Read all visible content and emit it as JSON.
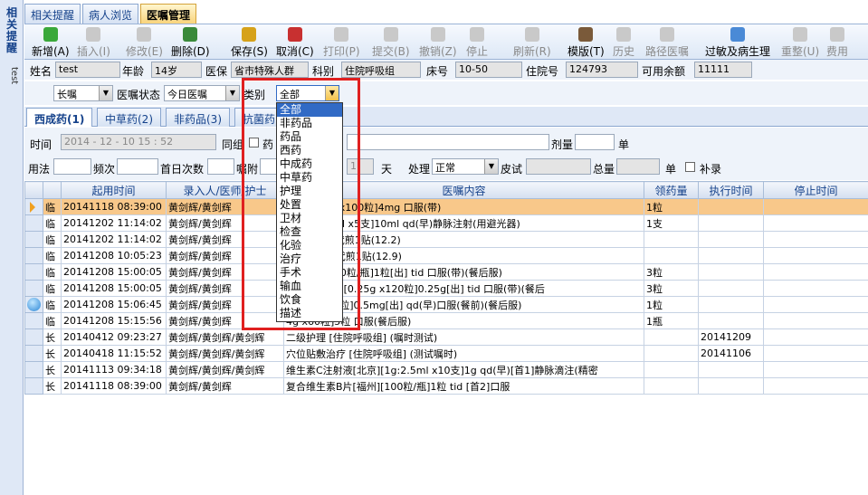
{
  "leftbar": {
    "title": "相关提醒",
    "vertical": "test"
  },
  "tabs": [
    "相关提醒",
    "病人浏览",
    "医嘱管理"
  ],
  "toolbar": [
    {
      "label": "新增(A)",
      "icon": "add-icon",
      "enabled": true,
      "color": "#3aa83a"
    },
    {
      "label": "插入(I)",
      "icon": "insert-icon",
      "enabled": false
    },
    {
      "label": "修改(E)",
      "icon": "edit-icon",
      "enabled": false
    },
    {
      "label": "删除(D)",
      "icon": "delete-icon",
      "enabled": true,
      "color": "#3a8a3a"
    },
    {
      "label": "保存(S)",
      "icon": "save-icon",
      "enabled": true,
      "color": "#d6a21a"
    },
    {
      "label": "取消(C)",
      "icon": "cancel-icon",
      "enabled": true,
      "color": "#c83030"
    },
    {
      "label": "打印(P)",
      "icon": "print-icon",
      "enabled": false
    },
    {
      "label": "提交(B)",
      "icon": "submit-icon",
      "enabled": false
    },
    {
      "label": "撤销(Z)",
      "icon": "undo-icon",
      "enabled": false
    },
    {
      "label": "停止",
      "icon": "stop-icon",
      "enabled": false
    },
    {
      "label": "刷新(R)",
      "icon": "refresh-icon",
      "enabled": false
    },
    {
      "label": "模版(T)",
      "icon": "template-icon",
      "enabled": true,
      "color": "#7a5a3a"
    },
    {
      "label": "历史",
      "icon": "history-icon",
      "enabled": false
    },
    {
      "label": "路径医嘱",
      "icon": "path-icon",
      "enabled": false
    },
    {
      "label": "过敏及病生理",
      "icon": "allergy-icon",
      "enabled": true,
      "color": "#4a8ad6"
    },
    {
      "label": "重整(U)",
      "icon": "reorganize-icon",
      "enabled": false
    },
    {
      "label": "费用",
      "icon": "fee-icon",
      "enabled": false
    }
  ],
  "patient": {
    "name_label": "姓名",
    "name": "test",
    "age_label": "年龄",
    "age": "14岁",
    "insurance_label": "医保",
    "insurance": "省市特殊人群",
    "dept_label": "科别",
    "dept": "住院呼吸组",
    "bed_label": "床号",
    "bed": "10-50",
    "hosp_label": "住院号",
    "hosp": "124793",
    "balance_label": "可用余额",
    "balance": "11111"
  },
  "filters": {
    "type": "长嘱",
    "status_label": "医嘱状态",
    "status": "今日医嘱",
    "category_label": "类别",
    "category": "全部"
  },
  "subtabs": [
    "西成药(1)",
    "中草药(2)",
    "非药品(3)",
    "抗菌药"
  ],
  "form": {
    "time_label": "时间",
    "time": "2014 - 12 - 10   15 : 52",
    "group_label": "同组",
    "drug_label": "药",
    "dose_label": "剂量",
    "dose_unit": "单",
    "usage_label": "用法",
    "freq_label": "频次",
    "first_label": "首日次数",
    "instr_label": "嘱附",
    "days_unit": "天",
    "process_label": "处理",
    "process": "正常",
    "skintest_label": "皮试",
    "total_label": "总量",
    "total_unit": "单",
    "supp_label": "补录",
    "days_value": "1"
  },
  "dropdown": [
    "全部",
    "非药品",
    "药品",
    "西药",
    "中成药",
    "中草药",
    "护理",
    "处置",
    "卫材",
    "检查",
    "化验",
    "治疗",
    "手术",
    "输血",
    "饮食",
    "描述"
  ],
  "grid": {
    "headers": [
      "",
      "起用时间",
      "录入人/医师/护士",
      "医嘱内容",
      "领药量",
      "执行时间",
      "停止时间"
    ],
    "rows": [
      {
        "type": "临",
        "start": "20141118 08:39:00",
        "doctor": "黄剑辉/黄剑辉",
        "content": "福州][4mg x100粒]4mg   口服(带)",
        "qty": "1粒",
        "exec": "",
        "stop": ""
      },
      {
        "type": "临",
        "start": "20141202 11:14:02",
        "doctor": "黄剑辉/黄剑辉",
        "content": "生射液[10ml x5支]10ml   qd(早)静脉注射(用避光器)",
        "qty": "1支",
        "exec": "",
        "stop": ""
      },
      {
        "type": "临",
        "start": "20141202 11:14:02",
        "doctor": "黄剑辉/黄剑辉",
        "content": "9g]1g   1贴代煎1贴(12.2)",
        "qty": "",
        "exec": "",
        "stop": ""
      },
      {
        "type": "临",
        "start": "20141208 10:05:23",
        "doctor": "黄剑辉/黄剑辉",
        "content": "袋]1克   1贴代煎1贴(12.9)",
        "qty": "",
        "exec": "",
        "stop": ""
      },
      {
        "type": "临",
        "start": "20141208 15:00:05",
        "doctor": "黄剑辉/黄剑辉",
        "content": "片[福州][100粒/瓶]1粒[出]   tid 口服(带)(餐后服)",
        "qty": "3粒",
        "exec": "",
        "stop": ""
      },
      {
        "type": "临",
        "start": "20141208 15:00:05",
        "doctor": "黄剑辉/黄剑辉",
        "content": "致钾片[海南][0.25g x120粒]0.25g[出]   tid 口服(带)(餐后",
        "qty": "3粒",
        "exec": "",
        "stop": ""
      },
      {
        "type": "临",
        "start": "20141208 15:06:45",
        "doctor": "黄剑辉/黄剑辉",
        "content": "0.5mg x20粒]0.5mg[出]   qd(早)口服(餐前)(餐后服)",
        "qty": "1粒",
        "exec": "",
        "stop": ""
      },
      {
        "type": "临",
        "start": "20141208 15:15:56",
        "doctor": "黄剑辉/黄剑辉",
        "content": "4g x60粒]5粒   口服(餐后服)",
        "qty": "1瓶",
        "exec": "",
        "stop": ""
      },
      {
        "type": "长",
        "start": "20140412 09:23:27",
        "doctor": "黄剑辉/黄剑辉/黄剑辉",
        "content": "二级护理   [住院呼吸组]   (嘱时测试)",
        "qty": "",
        "exec": "20141209",
        "stop": ""
      },
      {
        "type": "长",
        "start": "20140418 11:15:52",
        "doctor": "黄剑辉/黄剑辉/黄剑辉",
        "content": "穴位贴敷治疗   [住院呼吸组]   (测试嘱时)",
        "qty": "",
        "exec": "20141106",
        "stop": ""
      },
      {
        "type": "长",
        "start": "20141113 09:34:18",
        "doctor": "黄剑辉/黄剑辉/黄剑辉",
        "content": "维生素C注射液[北京][1g:2.5ml x10支]1g   qd(早)[首1]静脉滴注(精密",
        "qty": "",
        "exec": "",
        "stop": ""
      },
      {
        "type": "长",
        "start": "20141118 08:39:00",
        "doctor": "黄剑辉/黄剑辉",
        "content": "复合维生素B片[福州][100粒/瓶]1粒   tid [首2]口服",
        "qty": "",
        "exec": "",
        "stop": ""
      }
    ]
  }
}
